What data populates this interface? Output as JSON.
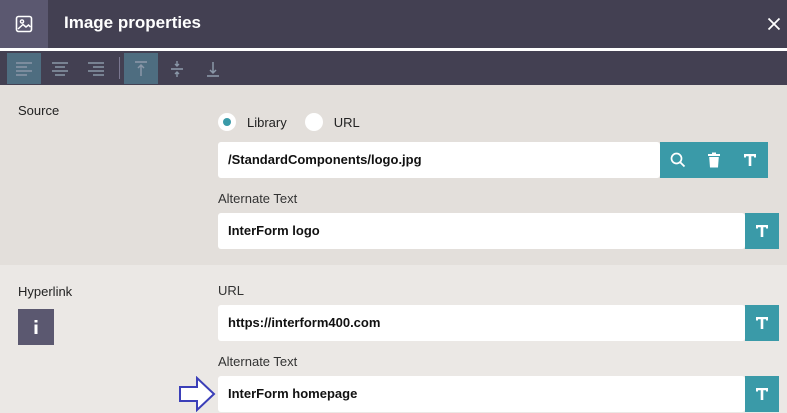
{
  "dialog": {
    "title": "Image properties",
    "title_icon": "image-icon",
    "close_icon": "close-icon"
  },
  "toolbar": {
    "buttons": [
      {
        "name": "align-left-icon",
        "active": true
      },
      {
        "name": "align-center-icon",
        "active": false
      },
      {
        "name": "align-right-icon",
        "active": false
      },
      {
        "name": "align-top-icon",
        "active": true
      },
      {
        "name": "align-middle-icon",
        "active": false
      },
      {
        "name": "align-bottom-icon",
        "active": false
      }
    ]
  },
  "source": {
    "label": "Source",
    "radio_library": "Library",
    "radio_url": "URL",
    "selected": "Library",
    "path_value": "/StandardComponents/logo.jpg",
    "alt_label": "Alternate Text",
    "alt_value": "InterForm logo"
  },
  "hyperlink": {
    "label": "Hyperlink",
    "url_label": "URL",
    "url_value": "https://interform400.com",
    "alt_label": "Alternate Text",
    "alt_value": "InterForm homepage"
  },
  "colors": {
    "titlebar": "#434052",
    "accent": "#3a9aa8",
    "active_tool": "#4e6d80"
  }
}
